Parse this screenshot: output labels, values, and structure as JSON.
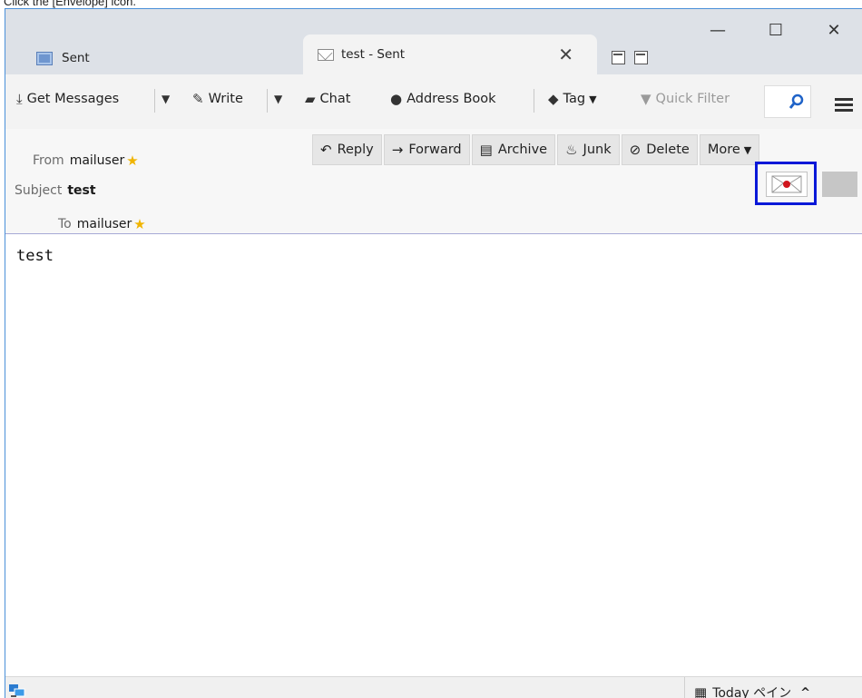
{
  "instruction": "Click the [Envelope] icon.",
  "tabs": [
    {
      "label": "Sent"
    },
    {
      "label": "test - Sent"
    }
  ],
  "window_controls": {
    "minimize": "—",
    "maximize": "☐",
    "close": "✕"
  },
  "toolbar": {
    "get_messages": "Get Messages",
    "write": "Write",
    "chat": "Chat",
    "address_book": "Address Book",
    "tag": "Tag",
    "quick_filter": "Quick Filter"
  },
  "header": {
    "from_label": "From",
    "from_value": "mailuser",
    "subject_label": "Subject",
    "subject_value": "test",
    "to_label": "To",
    "to_value": "mailuser"
  },
  "actions": {
    "reply": "Reply",
    "forward": "Forward",
    "archive": "Archive",
    "junk": "Junk",
    "delete": "Delete",
    "more": "More"
  },
  "body": {
    "text": "test"
  },
  "statusbar": {
    "today_pane": "Today ペイン"
  },
  "icons": {
    "folder": "folder-icon",
    "envelope": "envelope-icon",
    "search": "search-icon",
    "menu": "hamburger-menu-icon"
  },
  "colors": {
    "highlight": "#0a18d8",
    "accent": "#4a90d9",
    "star": "#f0b400"
  }
}
